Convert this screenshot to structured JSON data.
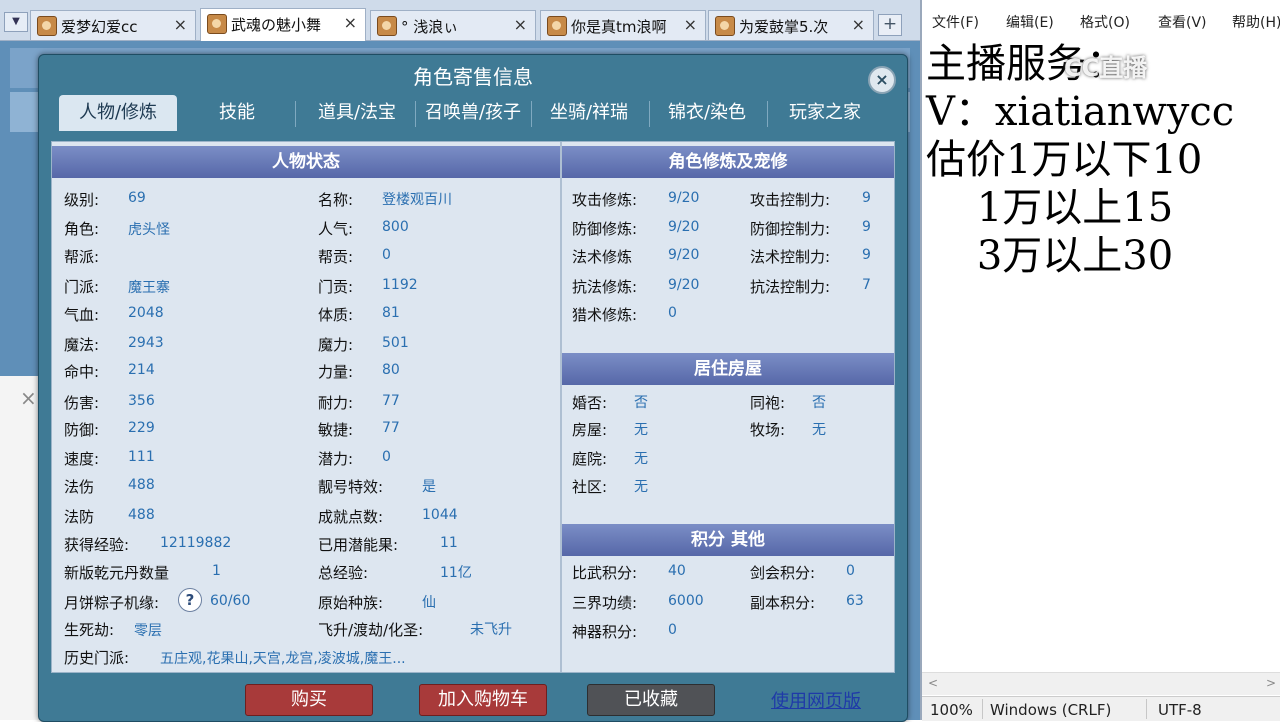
{
  "browser_tabs": [
    {
      "title": "爱梦幻爱cc",
      "close": "×"
    },
    {
      "title": "武魂の魅小舞",
      "close": "×"
    },
    {
      "title": "°  浅浪ぃ",
      "close": "×"
    },
    {
      "title": "你是真tm浪啊",
      "close": "×"
    },
    {
      "title": "为爱鼓掌5.次",
      "close": "×"
    }
  ],
  "tab_add": "+",
  "tab_menu": "▼",
  "side_panel": {
    "close": "×",
    "scroll_up": "▲"
  },
  "dialog": {
    "title": "角色寄售信息",
    "close": "×",
    "tabs": [
      "人物/修炼",
      "技能",
      "道具/法宝",
      "召唤兽/孩子",
      "坐骑/祥瑞",
      "锦衣/染色",
      "玩家之家"
    ],
    "sections": {
      "status": "人物状态",
      "cultivation": "角色修炼及宠修",
      "house": "居住房屋",
      "score": "积分 其他"
    },
    "status_left": [
      {
        "label": "级别:",
        "value": "69"
      },
      {
        "label": "角色:",
        "value": "虎头怪"
      },
      {
        "label": "帮派:",
        "value": ""
      },
      {
        "label": "门派:",
        "value": "魔王寨"
      },
      {
        "label": "气血:",
        "value": "2048"
      },
      {
        "label": "魔法:",
        "value": "2943"
      },
      {
        "label": "命中:",
        "value": "214"
      },
      {
        "label": "伤害:",
        "value": "356"
      },
      {
        "label": "防御:",
        "value": "229"
      },
      {
        "label": "速度:",
        "value": "111"
      },
      {
        "label": "法伤",
        "value": "488"
      },
      {
        "label": "法防",
        "value": "488"
      },
      {
        "label": "获得经验:",
        "value": "12119882"
      },
      {
        "label": "新版乾元丹数量",
        "value": "1"
      },
      {
        "label": "月饼粽子机缘:",
        "value": "60/60"
      },
      {
        "label": "生死劫:",
        "value": "零层"
      },
      {
        "label": "历史门派:",
        "value": "五庄观,花果山,天宫,龙宫,凌波城,魔王..."
      }
    ],
    "help_icon": "?",
    "status_right": [
      {
        "label": "名称:",
        "value": "登楼观百川"
      },
      {
        "label": "人气:",
        "value": "800"
      },
      {
        "label": "帮贡:",
        "value": "0"
      },
      {
        "label": "门贡:",
        "value": "1192"
      },
      {
        "label": "体质:",
        "value": "81"
      },
      {
        "label": "魔力:",
        "value": "501"
      },
      {
        "label": "力量:",
        "value": "80"
      },
      {
        "label": "耐力:",
        "value": "77"
      },
      {
        "label": "敏捷:",
        "value": "77"
      },
      {
        "label": "潜力:",
        "value": "0"
      },
      {
        "label": "靓号特效:",
        "value": "是"
      },
      {
        "label": "成就点数:",
        "value": "1044"
      },
      {
        "label": "已用潜能果:",
        "value": "11"
      },
      {
        "label": "总经验:",
        "value": "11亿"
      },
      {
        "label": "原始种族:",
        "value": "仙"
      },
      {
        "label": "飞升/渡劫/化圣:",
        "value": "未飞升"
      }
    ],
    "cultivation_left": [
      {
        "label": "攻击修炼:",
        "value": "9/20"
      },
      {
        "label": "防御修炼:",
        "value": "9/20"
      },
      {
        "label": "法术修炼",
        "value": "9/20"
      },
      {
        "label": "抗法修炼:",
        "value": "9/20"
      },
      {
        "label": "猎术修炼:",
        "value": "0"
      }
    ],
    "cultivation_right": [
      {
        "label": "攻击控制力:",
        "value": "9"
      },
      {
        "label": "防御控制力:",
        "value": "9"
      },
      {
        "label": "法术控制力:",
        "value": "9"
      },
      {
        "label": "抗法控制力:",
        "value": "7"
      }
    ],
    "house_left": [
      {
        "label": "婚否:",
        "value": "否"
      },
      {
        "label": "房屋:",
        "value": "无"
      },
      {
        "label": "庭院:",
        "value": "无"
      },
      {
        "label": "社区:",
        "value": "无"
      }
    ],
    "house_right": [
      {
        "label": "同袍:",
        "value": "否"
      },
      {
        "label": "牧场:",
        "value": "无"
      }
    ],
    "score_left": [
      {
        "label": "比武积分:",
        "value": "40"
      },
      {
        "label": "三界功绩:",
        "value": "6000"
      },
      {
        "label": "神器积分:",
        "value": "0"
      }
    ],
    "score_right": [
      {
        "label": "剑会积分:",
        "value": "0"
      },
      {
        "label": "副本积分:",
        "value": "63"
      }
    ],
    "buttons": {
      "buy": "购买",
      "cart": "加入购物车",
      "fav": "已收藏",
      "web": "使用网页版"
    }
  },
  "notepad": {
    "menu": [
      "文件(F)",
      "编辑(E)",
      "格式(O)",
      "查看(V)",
      "帮助(H)"
    ],
    "lines": [
      "主播服务：",
      "V：xiatianwycc",
      "估价1万以下10",
      "    1万以上15",
      "    3万以上30"
    ],
    "status": {
      "zoom": "100%",
      "eol": "Windows (CRLF)",
      "encoding": "UTF-8"
    },
    "scroll_left": "<",
    "scroll_right": ">"
  },
  "watermark": "CC直播"
}
